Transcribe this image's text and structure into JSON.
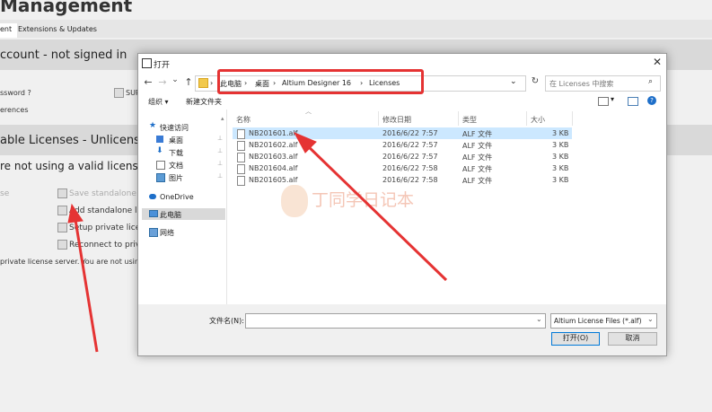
{
  "background": {
    "title": "Management",
    "tabs": [
      "ent",
      "Extensions & Updates"
    ],
    "account_header": "ccount - not signed in",
    "password_label": "ssword ?",
    "references_label": "erences",
    "sur_label": "SUR",
    "licenses_header": "able Licenses - Unlicensed",
    "warning_text": "re not using a valid license. Click",
    "se_label": "se",
    "save_standalone": "Save standalone lice",
    "add_standalone": "Add standalone licen",
    "setup_private": "Setup private license",
    "reconnect_private": "Reconnect to private",
    "private_server_text": "private license server. You are not using any lic"
  },
  "dialog": {
    "title": "打开",
    "close_glyph": "✕",
    "nav": {
      "back": "←",
      "forward": "→",
      "dropdown": "⌄",
      "up": "↑"
    },
    "breadcrumb": [
      "此电脑",
      "桌面",
      "Altium Designer 16",
      "Licenses"
    ],
    "breadcrumb_sep": "›",
    "refresh_glyph": "↻",
    "search_placeholder": "在 Licenses 中搜索",
    "toolbar": {
      "organize": "组织 ▾",
      "new_folder": "新建文件夹"
    },
    "nav_pane": [
      {
        "label": "快速访问",
        "icon": "star-icon",
        "pinned": false
      },
      {
        "label": "桌面",
        "icon": "desktop-icon",
        "pinned": true
      },
      {
        "label": "下载",
        "icon": "download-icon",
        "pinned": true
      },
      {
        "label": "文档",
        "icon": "documents-icon",
        "pinned": true
      },
      {
        "label": "图片",
        "icon": "pictures-icon",
        "pinned": true
      },
      {
        "label": "OneDrive",
        "icon": "cloud-icon",
        "pinned": false
      },
      {
        "label": "此电脑",
        "icon": "computer-icon",
        "pinned": false
      },
      {
        "label": "网络",
        "icon": "network-icon",
        "pinned": false
      }
    ],
    "pin_glyph": "📌",
    "columns": {
      "name": "名称",
      "date": "修改日期",
      "type": "类型",
      "size": "大小"
    },
    "files": [
      {
        "name": "NB201601.alf",
        "date": "2016/6/22 7:57",
        "type": "ALF 文件",
        "size": "3 KB",
        "selected": true
      },
      {
        "name": "NB201602.alf",
        "date": "2016/6/22 7:57",
        "type": "ALF 文件",
        "size": "3 KB",
        "selected": false
      },
      {
        "name": "NB201603.alf",
        "date": "2016/6/22 7:57",
        "type": "ALF 文件",
        "size": "3 KB",
        "selected": false
      },
      {
        "name": "NB201604.alf",
        "date": "2016/6/22 7:58",
        "type": "ALF 文件",
        "size": "3 KB",
        "selected": false
      },
      {
        "name": "NB201605.alf",
        "date": "2016/6/22 7:58",
        "type": "ALF 文件",
        "size": "3 KB",
        "selected": false
      }
    ],
    "filename_label": "文件名(N):",
    "filename_value": "",
    "filter_value": "Altium License Files (*.alf)",
    "open_button": "打开(O)",
    "cancel_button": "取消"
  },
  "watermark": "丁同学日记本",
  "colors": {
    "annotation": "#e53333",
    "selection": "#cce8ff",
    "accent": "#0078d7"
  }
}
